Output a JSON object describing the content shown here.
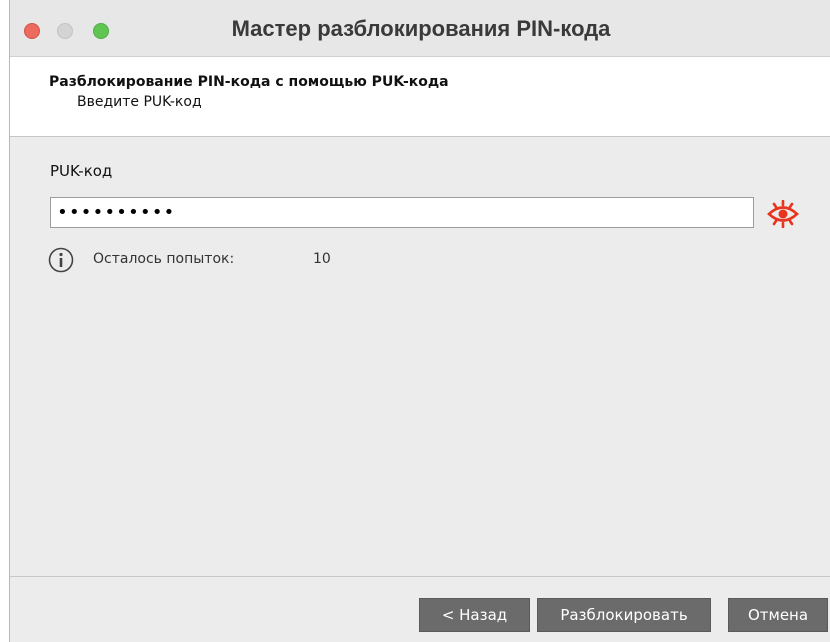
{
  "window": {
    "title": "Мастер разблокирования PIN-кода"
  },
  "header": {
    "title": "Разблокирование PIN-кода с помощью PUK-кода",
    "subtitle": "Введите PUK-код"
  },
  "form": {
    "puk_label": "PUK-код",
    "puk_value": "••••••••••",
    "show_password_icon": "eye-icon",
    "show_password_icon_color": "#e8341c"
  },
  "info": {
    "icon": "info-icon",
    "attempts_label": "Осталось попыток:",
    "attempts_value": "10"
  },
  "buttons": {
    "back_label": "< Назад",
    "unlock_label": "Разблокировать",
    "cancel_label": "Отмена"
  },
  "colors": {
    "button_bg": "#6b6b6b",
    "close": "#ec6a5e",
    "minimize": "#d4d4d4",
    "maximize": "#61c554"
  }
}
